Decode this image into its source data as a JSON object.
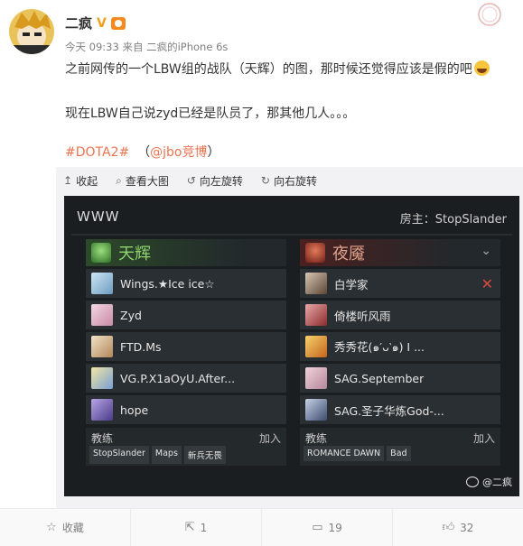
{
  "post": {
    "author": "二疯",
    "meta": "今天 09:33 来自 二疯的iPhone 6s",
    "line1": "之前网传的一个LBW组的战队（天辉）的图，那时候还觉得应该是假的吧",
    "line2": "现在LBW自己说zyd已经是队员了，那其他几人。。。",
    "hashtag": "#DOTA2#",
    "mention_prefix": "（",
    "mention": "@jbo竞博",
    "mention_suffix": "）"
  },
  "toolbar": {
    "collapse": "收起",
    "view_large": "查看大图",
    "rotate_left": "向左旋转",
    "rotate_right": "向右旋转"
  },
  "lobby": {
    "title": "WWW",
    "host": "房主：StopSlander",
    "radiant": {
      "name": "天辉",
      "players": [
        "Wings.★Ice ice☆",
        "Zyd",
        "FTD.Ms",
        "VG.P.X1aOyU.After...",
        "hope"
      ],
      "coach_label": "教练",
      "join": "加入",
      "spectators": [
        "StopSlander",
        "Maps",
        "新兵无畏"
      ]
    },
    "dire": {
      "name": "夜魇",
      "players": [
        "白学家",
        "倚楼听风雨",
        "秀秀花(๑′ᴗ‵๑) I ...",
        "SAG.September",
        "SAG.圣子华炼God-..."
      ],
      "coach_label": "教练",
      "join": "加入",
      "spectators": [
        "ROMANCE DAWN",
        "Bad"
      ]
    },
    "watermark": "@二疯"
  },
  "footer": {
    "favorite": "收藏",
    "repost": "1",
    "comment": "19",
    "like": "32"
  },
  "colors": {
    "link": "#eb7350",
    "radiant": "#8fd36c",
    "dire": "#e0a18a"
  },
  "icons": [
    "verified-v-icon",
    "level-badge-icon",
    "laugh-emoji-icon",
    "collapse-icon",
    "search-icon",
    "rotate-left-icon",
    "rotate-right-icon",
    "chevron-down-icon",
    "kick-x-icon",
    "weibo-icon",
    "star-icon",
    "repost-icon",
    "comment-icon",
    "like-icon"
  ]
}
